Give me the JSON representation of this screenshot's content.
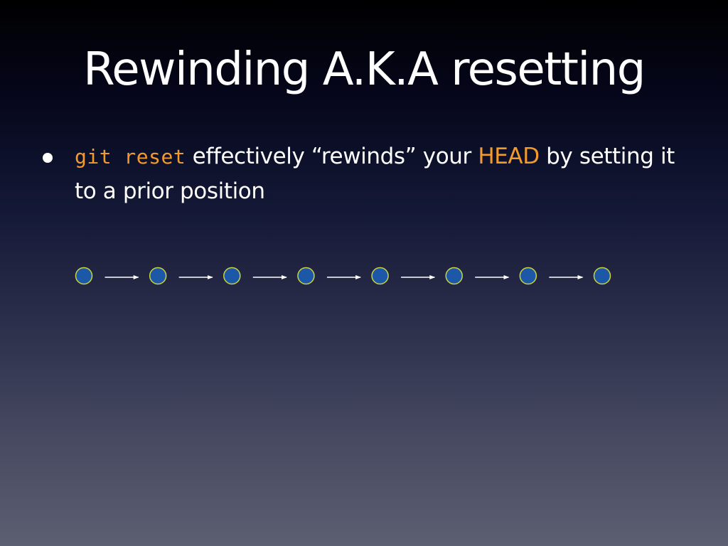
{
  "slide": {
    "title": "Rewinding A.K.A resetting",
    "bullet": {
      "command": "git reset",
      "text_before_head": " effectively “rewinds” your ",
      "head": "HEAD",
      "text_after_head": " by setting it to a prior position"
    }
  },
  "colors": {
    "accent": "#f29a2e",
    "commit_fill": "#1c57a8",
    "commit_stroke": "#c8d43a",
    "arrow": "#ffffff"
  },
  "chart_data": {
    "type": "diagram",
    "nodes": [
      {
        "id": "c1"
      },
      {
        "id": "c2"
      },
      {
        "id": "c3"
      },
      {
        "id": "c4"
      },
      {
        "id": "c5"
      },
      {
        "id": "c6"
      },
      {
        "id": "c7"
      },
      {
        "id": "c8"
      }
    ],
    "edges": [
      {
        "from": "c1",
        "to": "c2"
      },
      {
        "from": "c2",
        "to": "c3"
      },
      {
        "from": "c3",
        "to": "c4"
      },
      {
        "from": "c4",
        "to": "c5"
      },
      {
        "from": "c5",
        "to": "c6"
      },
      {
        "from": "c6",
        "to": "c7"
      },
      {
        "from": "c7",
        "to": "c8"
      }
    ]
  }
}
